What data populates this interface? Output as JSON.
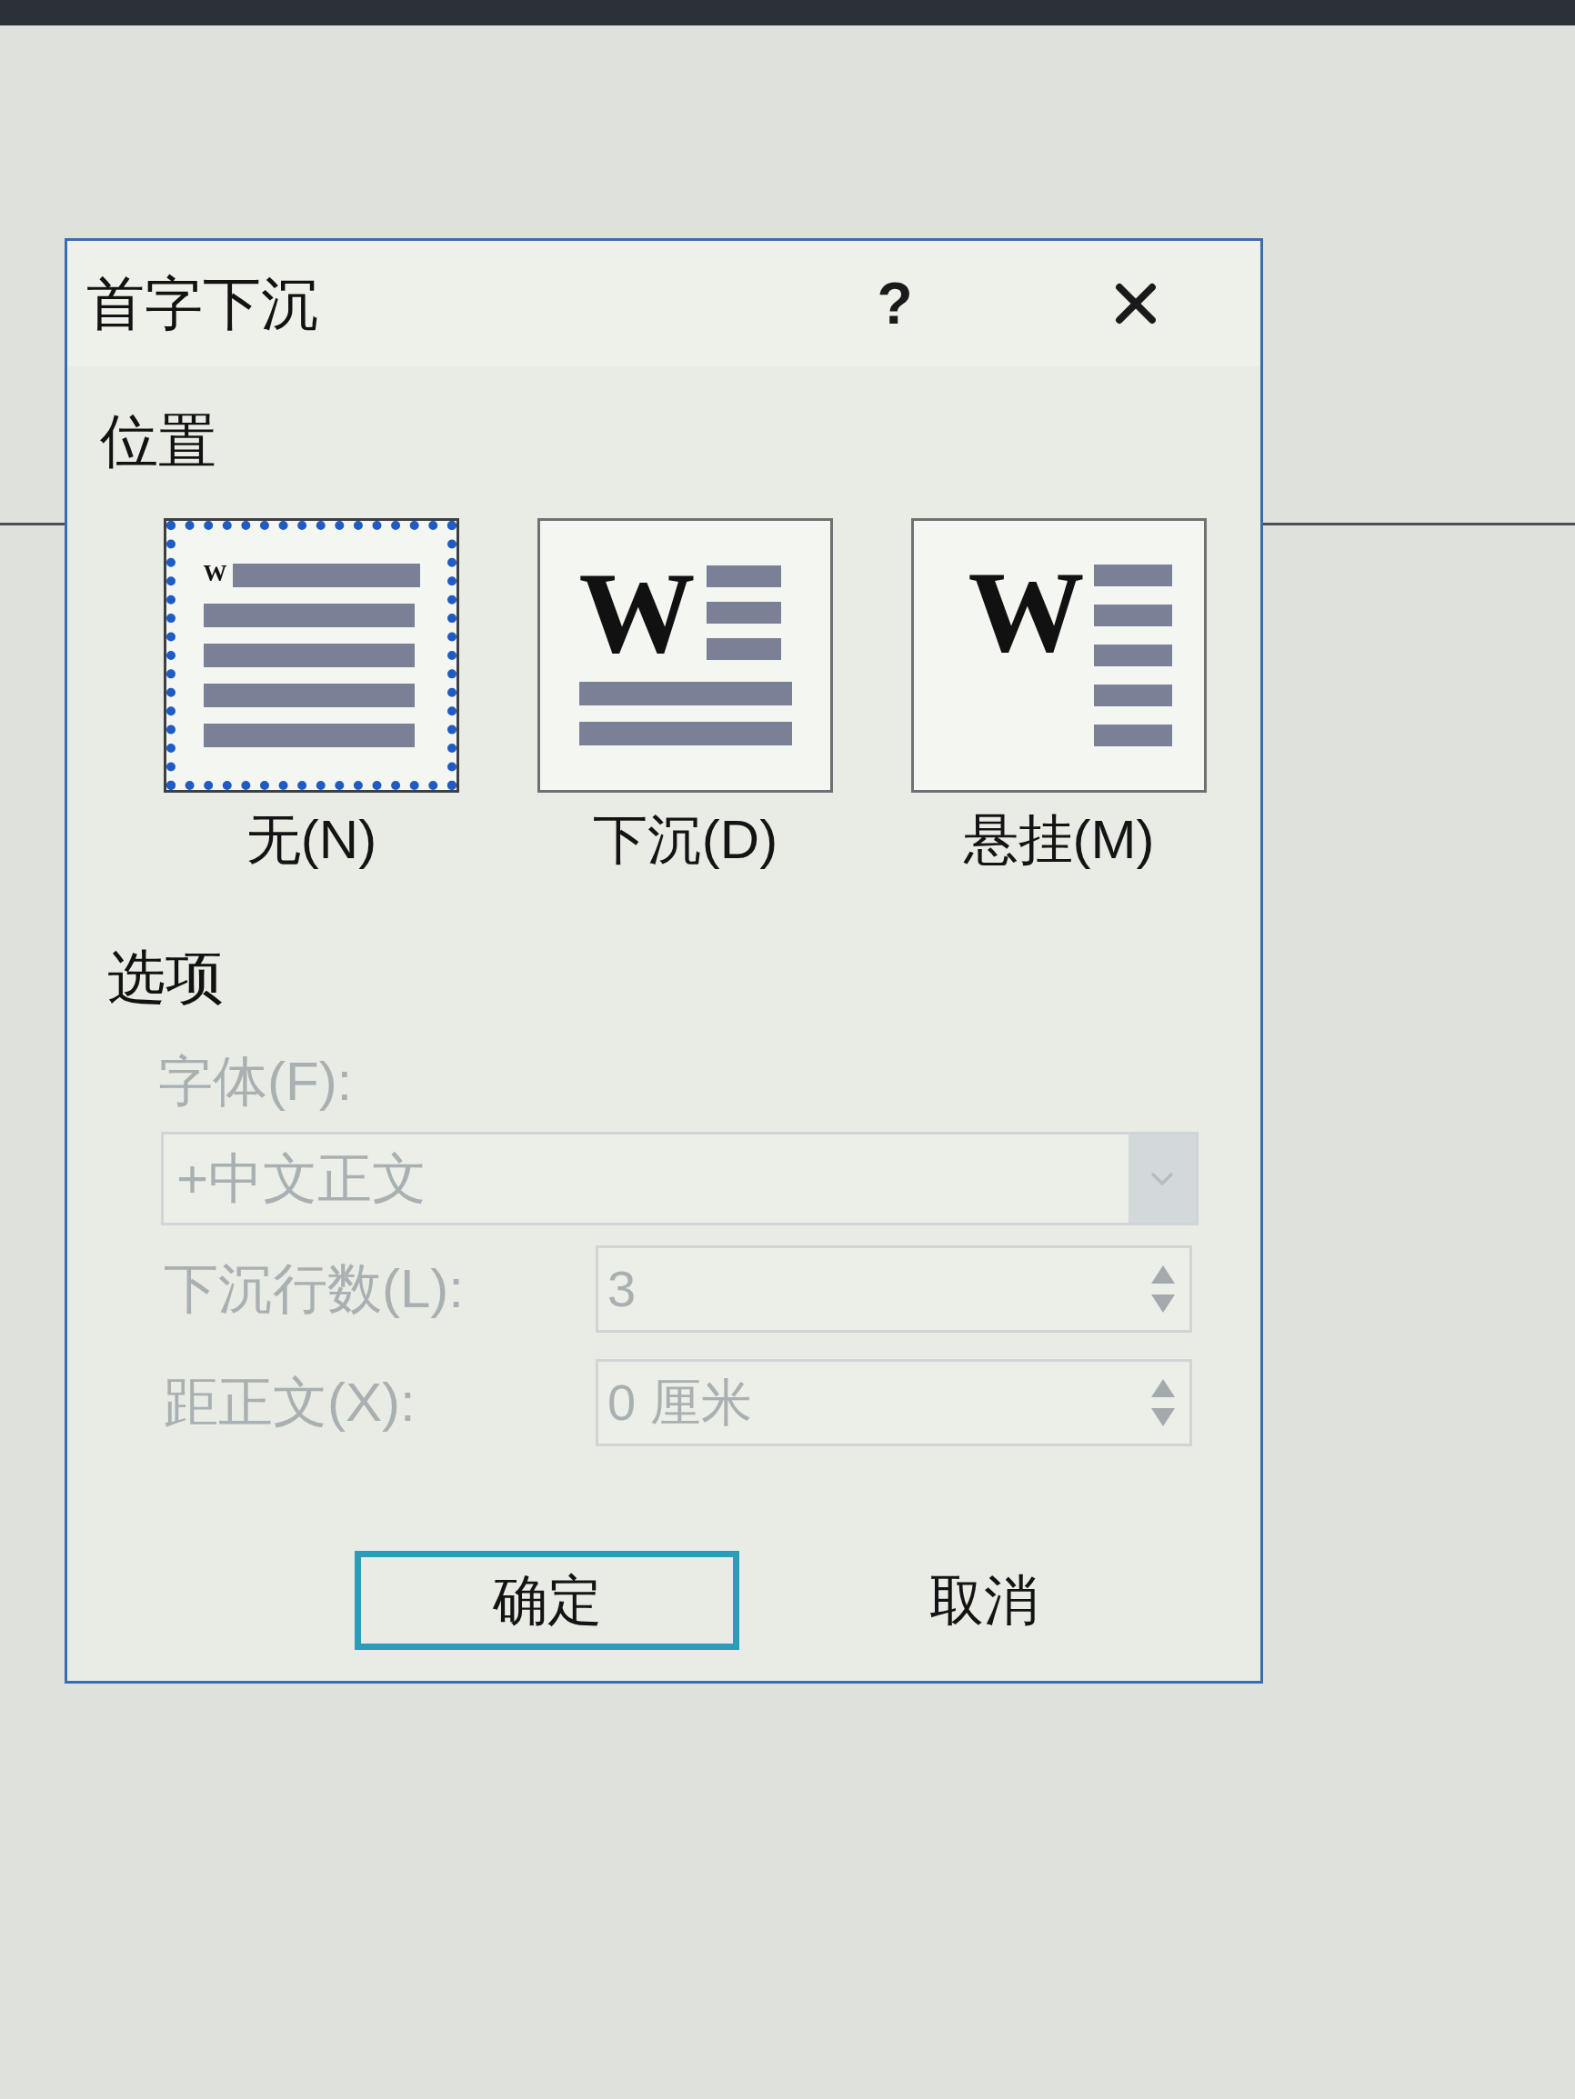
{
  "dialog": {
    "title": "首字下沉",
    "help_button": "?"
  },
  "position": {
    "heading": "位置",
    "options": [
      {
        "kind": "none",
        "preview_letter": "W",
        "label": "无(N)",
        "selected": true
      },
      {
        "kind": "dropped",
        "preview_letter": "W",
        "label": "下沉(D)",
        "selected": false
      },
      {
        "kind": "in_margin",
        "preview_letter": "W",
        "label": "悬挂(M)",
        "selected": false
      }
    ]
  },
  "options": {
    "heading": "选项",
    "font": {
      "label": "字体(F):",
      "value": "+中文正文",
      "disabled": true
    },
    "lines_to_drop": {
      "label": "下沉行数(L):",
      "value": "3",
      "disabled": true
    },
    "distance_from_text": {
      "label": "距正文(X):",
      "value": "0 厘米",
      "disabled": true
    }
  },
  "buttons": [
    {
      "label": "确定",
      "default": true
    },
    {
      "label": "取消",
      "default": false
    }
  ]
}
